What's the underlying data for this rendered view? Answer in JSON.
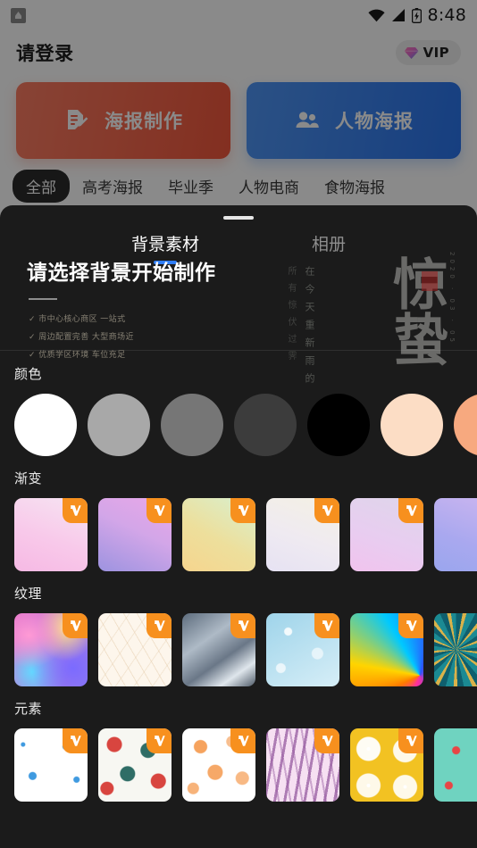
{
  "statusbar": {
    "app_icon": "app-notification-icon",
    "wifi_icon": "wifi-icon",
    "signal_icon": "signal-icon",
    "battery_icon": "battery-icon",
    "time": "8:48"
  },
  "header": {
    "title": "请登录",
    "vip": {
      "label": "VIP",
      "icon": "gem-icon",
      "bg": "#eeeeee"
    }
  },
  "actions": [
    {
      "label": "海报制作",
      "icon": "document-edit-icon",
      "color": "#f2573c"
    },
    {
      "label": "人物海报",
      "icon": "people-icon",
      "color": "#2a74ec"
    }
  ],
  "category_tabs": {
    "active_index": 0,
    "items": [
      {
        "label": "全部"
      },
      {
        "label": "高考海报"
      },
      {
        "label": "毕业季"
      },
      {
        "label": "人物电商"
      },
      {
        "label": "食物海报"
      }
    ]
  },
  "background_cards": [
    {
      "title": "请选择背景开始制作",
      "bullets": [
        "✓ 市中心核心商区 一站式",
        "✓ 周边配置完善  大型商场近",
        "✓ 优质学区环境 车位充足"
      ]
    },
    {
      "big_text": "惊蛰",
      "column_text": "在今天重新雨的",
      "column_text2": "所有惊伏过霁",
      "date_text": "2020 · 03 · 05"
    }
  ],
  "sheet": {
    "grabber": "drag-handle",
    "tabs": {
      "active_index": 0,
      "items": [
        {
          "label": "背景素材"
        },
        {
          "label": "相册"
        }
      ]
    },
    "accent": "#2f7df6",
    "sections": [
      {
        "id": "color",
        "title": "颜色",
        "kind": "circles",
        "items": [
          {
            "name": "white",
            "color": "#ffffff"
          },
          {
            "name": "light-gray",
            "color": "#a8a8a8"
          },
          {
            "name": "mid-gray",
            "color": "#767676"
          },
          {
            "name": "dark-gray",
            "color": "#3c3c3c"
          },
          {
            "name": "black",
            "color": "#000000"
          },
          {
            "name": "peach",
            "color": "#fcddc5"
          },
          {
            "name": "salmon",
            "color": "#f7a97f"
          }
        ]
      },
      {
        "id": "gradient",
        "title": "渐变",
        "kind": "gradients",
        "badge": "V",
        "items": [
          {
            "name": "pink-blush",
            "gradient": "linear-gradient(200deg,#f6e4f2 0%,#f8c9ea 55%,#f6b9e4 100%)",
            "vip": true
          },
          {
            "name": "violet-rose",
            "gradient": "linear-gradient(205deg,#e9a8e8 0%,#d3a6e8 45%,#9d93e0 100%)",
            "vip": true
          },
          {
            "name": "mint-butter",
            "gradient": "linear-gradient(210deg,#d8f0cf 0%,#eddf9c 55%,#f6d58e 100%)",
            "vip": true
          },
          {
            "name": "ivory-lilac",
            "gradient": "linear-gradient(200deg,#f4f1e3 0%,#efeaf1 55%,#e6e2f3 100%)",
            "vip": true
          },
          {
            "name": "lavender-pink",
            "gradient": "linear-gradient(200deg,#ded6ea 0%,#e8cdf0 55%,#f1c3ee 100%)",
            "vip": true
          },
          {
            "name": "periwinkle",
            "gradient": "linear-gradient(200deg,#cdb6ef 0%,#a9a8ef 60%,#9aa6ee 100%)",
            "vip": true
          }
        ]
      },
      {
        "id": "texture",
        "title": "纹理",
        "kind": "textures",
        "badge": "V",
        "items": [
          {
            "name": "holographic-swirl",
            "class": "tx1",
            "vip": true
          },
          {
            "name": "cream-leaf-line",
            "class": "tx2",
            "vip": true
          },
          {
            "name": "gray-marble-wave",
            "class": "tx3",
            "vip": true
          },
          {
            "name": "ice-blue-crackle",
            "class": "tx4",
            "vip": true
          },
          {
            "name": "rainbow-fan",
            "class": "tx5",
            "vip": true
          },
          {
            "name": "teal-gold-swirl",
            "class": "tx6",
            "vip": true
          }
        ]
      },
      {
        "id": "element",
        "title": "元素",
        "kind": "elements",
        "badge": "V",
        "items": [
          {
            "name": "blue-snowflakes",
            "class": "el1",
            "vip": true
          },
          {
            "name": "christmas-baubles",
            "class": "el2",
            "vip": true
          },
          {
            "name": "orange-citrus-line",
            "class": "el3",
            "vip": true
          },
          {
            "name": "purple-leaf-pink",
            "class": "el4",
            "vip": true
          },
          {
            "name": "lemon-slices",
            "class": "el5",
            "vip": true
          },
          {
            "name": "birds-on-teal",
            "class": "el6",
            "vip": true
          }
        ]
      }
    ]
  }
}
